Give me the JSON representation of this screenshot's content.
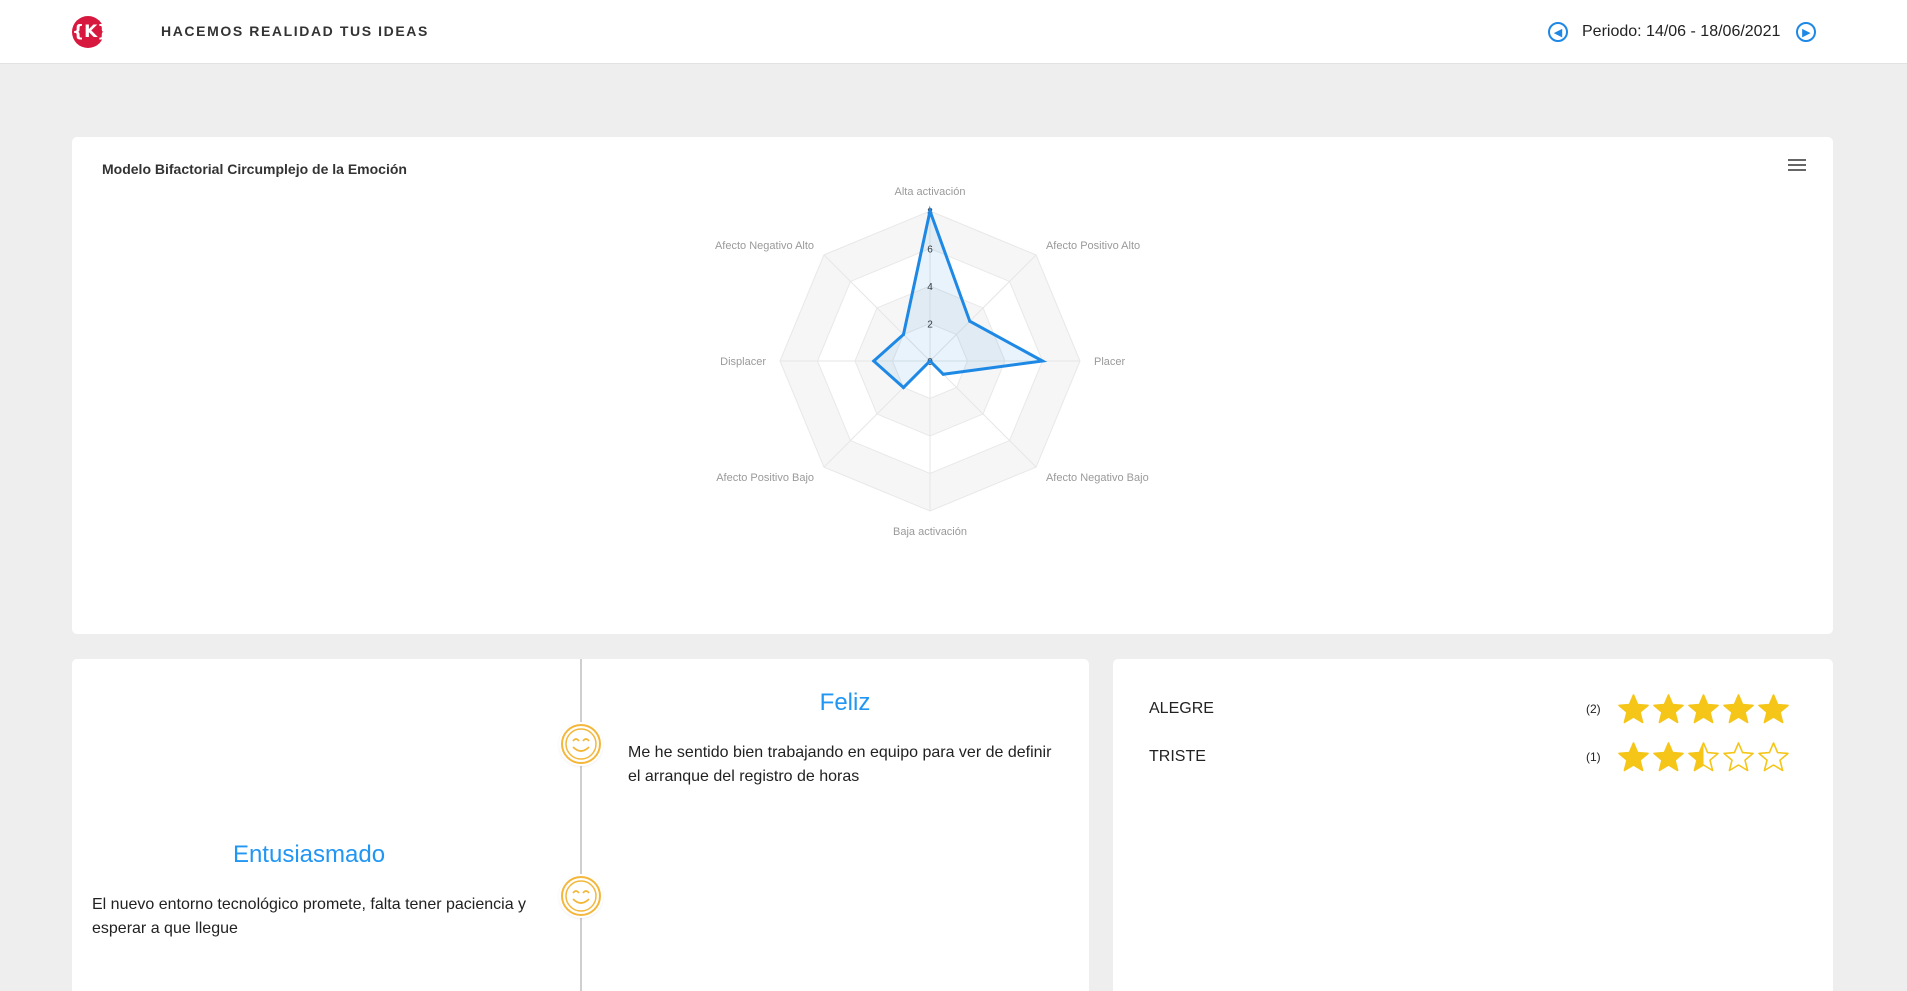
{
  "header": {
    "logo_text": "{K}",
    "tagline": "HACEMOS REALIDAD TUS IDEAS",
    "period_label": "Periodo: 14/06 - 18/06/2021",
    "prev_icon": "arrow-left-circle-icon",
    "next_icon": "arrow-right-circle-icon"
  },
  "chart_card": {
    "title": "Modelo Bifactorial Circumplejo de la Emoción",
    "menu_icon": "hamburger-menu-icon"
  },
  "chart_data": {
    "type": "radar",
    "title": "Modelo Bifactorial Circumplejo de la Emoción",
    "axes": [
      "Alta activación",
      "Afecto Positivo Alto",
      "Placer",
      "Afecto Negativo Bajo",
      "Baja activación",
      "Afecto Positivo Bajo",
      "Displacer",
      "Afecto Negativo Alto"
    ],
    "radial_ticks": [
      "0",
      "2",
      "4",
      "6",
      "8"
    ],
    "rmax": 8,
    "series": [
      {
        "values": [
          8,
          3,
          6,
          1,
          0,
          2,
          3,
          2
        ],
        "color": "#1e88e5"
      }
    ],
    "grid": true
  },
  "timeline": {
    "entries": [
      {
        "title": "Feliz",
        "text": "Me he sentido bien trabajando en equipo para ver de definir el arranque del registro de horas",
        "side": "right",
        "icon": "smiley-face-icon"
      },
      {
        "title": "Entusiasmado",
        "text": "El nuevo entorno tecnológico promete, falta tener paciencia y esperar a que llegue",
        "side": "left",
        "icon": "smiley-face-icon"
      }
    ]
  },
  "ratings": {
    "items": [
      {
        "label": "ALEGRE",
        "count": "(2)",
        "rating": 5,
        "max": 5
      },
      {
        "label": "TRISTE",
        "count": "(1)",
        "rating": 2.5,
        "max": 5
      }
    ],
    "star_color": "#f5c518"
  }
}
